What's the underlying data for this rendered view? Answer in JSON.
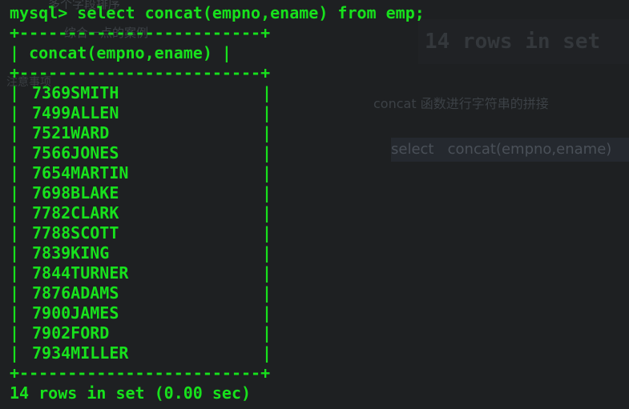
{
  "background": {
    "ghost_1": "多个字段排序",
    "ghost_2": "综合一点的案例",
    "ghost_3": "注意事项",
    "ghost_4": "concat 函数进行字符串的拼接",
    "ghost_big": "14 rows in set",
    "ghost_code": "select   concat(empno,ename)"
  },
  "terminal": {
    "prompt": "mysql> ",
    "command": "select concat(empno,ename) from emp;",
    "border_top": "+-------------------------+",
    "header": "| concat(empno,ename) |",
    "border_mid": "+-------------------------+",
    "border_bottom": "+-------------------------+",
    "pipe_left": "|",
    "pipe_right": "|",
    "rows": [
      "7369SMITH",
      "7499ALLEN",
      "7521WARD",
      "7566JONES",
      "7654MARTIN",
      "7698BLAKE",
      "7782CLARK",
      "7788SCOTT",
      "7839KING",
      "7844TURNER",
      "7876ADAMS",
      "7900JAMES",
      "7902FORD",
      "7934MILLER"
    ],
    "footer": "14 rows in set (0.00 sec)"
  },
  "colors": {
    "terminal_text": "#17e11c",
    "background": "#1e2022"
  }
}
